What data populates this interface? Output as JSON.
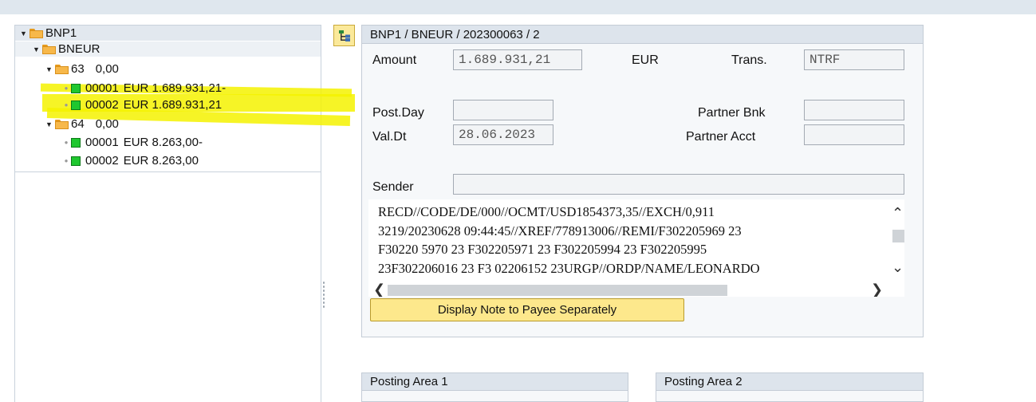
{
  "tree": {
    "root": "BNP1",
    "level1": "BNEUR",
    "stmt1": {
      "number": "63",
      "value": "0,00"
    },
    "stmt1_items": [
      {
        "id": "00001",
        "text": "EUR 1.689.931,21-"
      },
      {
        "id": "00002",
        "text": "EUR 1.689.931,21"
      }
    ],
    "stmt2": {
      "number": "64",
      "value": "0,00"
    },
    "stmt2_items": [
      {
        "id": "00001",
        "text": "EUR 8.263,00-"
      },
      {
        "id": "00002",
        "text": "EUR 8.263,00"
      }
    ]
  },
  "detail": {
    "title": "BNP1 / BNEUR / 202300063 / 2",
    "amount_label": "Amount",
    "amount_value": "1.689.931,21",
    "currency": "EUR",
    "trans_label": "Trans.",
    "trans_value": "NTRF",
    "postday_label": "Post.Day",
    "postday_value": "",
    "partner_bank_label": "Partner Bnk",
    "partner_bank_value": "",
    "valdt_label": "Val.Dt",
    "valdt_value": "28.06.2023",
    "partner_acct_label": "Partner Acct",
    "partner_acct_value": "",
    "sender_label": "Sender",
    "sender_value": "",
    "note_lines": [
      "RECD//CODE/DE/000//OCMT/USD1854373,35//EXCH/0,911",
      "3219/20230628 09:44:45//XREF/778913006//REMI/F302205969 23",
      "F30220 5970 23 F302205971 23 F302205994 23 F302205995",
      "23F302206016 23 F3 02206152 23URGP//ORDP/NAME/LEONARDO"
    ],
    "note_button": "Display Note to Payee Separately"
  },
  "posting_area_1": "Posting Area 1",
  "posting_area_2": "Posting Area 2",
  "colors": {
    "highlight": "#f5f200",
    "button_yellow": "#fde88c",
    "status_green": "#1fc72f",
    "folder_orange": "#f7b84a"
  }
}
